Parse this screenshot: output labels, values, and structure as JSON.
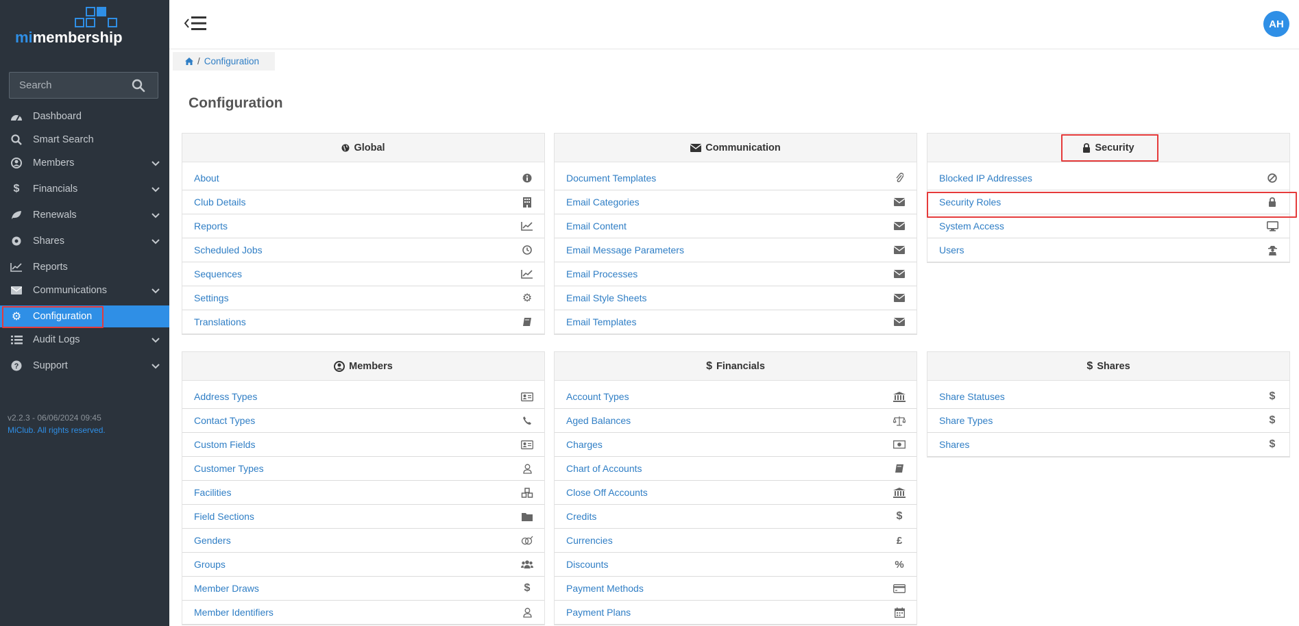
{
  "app": {
    "brand_prefix": "mi",
    "brand_suffix": "membership",
    "search_placeholder": "Search",
    "version": "v2.2.3 - 06/06/2024 09:45",
    "copyright": "MiClub. All rights reserved.",
    "avatar_initials": "AH",
    "accent_color": "#2f8fe6",
    "highlight_color": "#e53a3a"
  },
  "sidebar": {
    "items": [
      {
        "label": "Dashboard",
        "icon": "dashboard-icon",
        "has_submenu": false
      },
      {
        "label": "Smart Search",
        "icon": "search-icon",
        "has_submenu": false
      },
      {
        "label": "Members",
        "icon": "user-circle-icon",
        "has_submenu": true
      },
      {
        "label": "Financials",
        "icon": "dollar-icon",
        "has_submenu": true
      },
      {
        "label": "Renewals",
        "icon": "leaf-icon",
        "has_submenu": true
      },
      {
        "label": "Shares",
        "icon": "certificate-icon",
        "has_submenu": true
      },
      {
        "label": "Reports",
        "icon": "line-chart-icon",
        "has_submenu": false
      },
      {
        "label": "Communications",
        "icon": "envelope-icon",
        "has_submenu": true
      },
      {
        "label": "Configuration",
        "icon": "gear-icon",
        "has_submenu": false,
        "active": true
      },
      {
        "label": "Audit Logs",
        "icon": "list-icon",
        "has_submenu": true
      },
      {
        "label": "Support",
        "icon": "question-icon",
        "has_submenu": true
      }
    ]
  },
  "breadcrumb": {
    "home_icon": "home-icon",
    "current": "Configuration"
  },
  "page": {
    "title": "Configuration"
  },
  "panels": [
    {
      "title": "Global",
      "icon": "globe-icon",
      "rows": [
        {
          "label": "About",
          "icon": "info-icon"
        },
        {
          "label": "Club Details",
          "icon": "building-icon"
        },
        {
          "label": "Reports",
          "icon": "line-chart-icon"
        },
        {
          "label": "Scheduled Jobs",
          "icon": "clock-icon"
        },
        {
          "label": "Sequences",
          "icon": "line-chart-icon"
        },
        {
          "label": "Settings",
          "icon": "gear-icon"
        },
        {
          "label": "Translations",
          "icon": "book-icon"
        }
      ]
    },
    {
      "title": "Communication",
      "icon": "envelope-icon",
      "rows": [
        {
          "label": "Document Templates",
          "icon": "paperclip-icon"
        },
        {
          "label": "Email Categories",
          "icon": "envelope-icon"
        },
        {
          "label": "Email Content",
          "icon": "envelope-icon"
        },
        {
          "label": "Email Message Parameters",
          "icon": "envelope-icon"
        },
        {
          "label": "Email Processes",
          "icon": "envelope-icon"
        },
        {
          "label": "Email Style Sheets",
          "icon": "envelope-icon"
        },
        {
          "label": "Email Templates",
          "icon": "envelope-icon"
        }
      ]
    },
    {
      "title": "Security",
      "icon": "lock-icon",
      "rows": [
        {
          "label": "Blocked IP Addresses",
          "icon": "ban-icon"
        },
        {
          "label": "Security Roles",
          "icon": "lock-icon"
        },
        {
          "label": "System Access",
          "icon": "desktop-icon"
        },
        {
          "label": "Users",
          "icon": "user-secret-icon"
        }
      ]
    },
    {
      "title": "Members",
      "icon": "user-circle-icon",
      "rows": [
        {
          "label": "Address Types",
          "icon": "address-card-icon"
        },
        {
          "label": "Contact Types",
          "icon": "phone-icon"
        },
        {
          "label": "Custom Fields",
          "icon": "id-card-icon"
        },
        {
          "label": "Customer Types",
          "icon": "user-outline-icon"
        },
        {
          "label": "Facilities",
          "icon": "cubes-icon"
        },
        {
          "label": "Field Sections",
          "icon": "folder-icon"
        },
        {
          "label": "Genders",
          "icon": "genderless-icon"
        },
        {
          "label": "Groups",
          "icon": "users-icon"
        },
        {
          "label": "Member Draws",
          "icon": "dollar-icon"
        },
        {
          "label": "Member Identifiers",
          "icon": "user-outline-icon"
        }
      ]
    },
    {
      "title": "Financials",
      "icon": "dollar-icon",
      "rows": [
        {
          "label": "Account Types",
          "icon": "bank-icon"
        },
        {
          "label": "Aged Balances",
          "icon": "balance-scale-icon"
        },
        {
          "label": "Charges",
          "icon": "money-icon"
        },
        {
          "label": "Chart of Accounts",
          "icon": "book-icon"
        },
        {
          "label": "Close Off Accounts",
          "icon": "bank-icon"
        },
        {
          "label": "Credits",
          "icon": "dollar-icon"
        },
        {
          "label": "Currencies",
          "icon": "pound-icon"
        },
        {
          "label": "Discounts",
          "icon": "percent-icon"
        },
        {
          "label": "Payment Methods",
          "icon": "credit-card-icon"
        },
        {
          "label": "Payment Plans",
          "icon": "calendar-icon"
        }
      ]
    },
    {
      "title": "Shares",
      "icon": "dollar-icon",
      "rows": [
        {
          "label": "Share Statuses",
          "icon": "dollar-icon"
        },
        {
          "label": "Share Types",
          "icon": "dollar-icon"
        },
        {
          "label": "Shares",
          "icon": "dollar-icon"
        }
      ]
    }
  ]
}
